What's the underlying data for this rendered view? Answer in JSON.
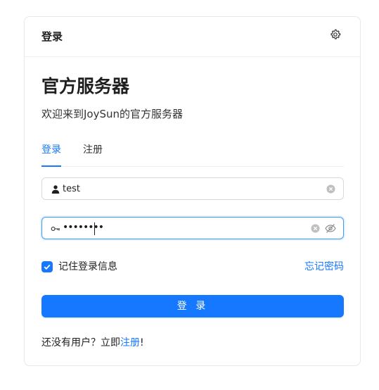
{
  "header": {
    "title": "登录",
    "settings_icon": "gear-icon"
  },
  "main": {
    "title": "官方服务器",
    "subtitle": "欢迎来到JoySun的官方服务器"
  },
  "tabs": [
    {
      "label": "登录",
      "active": true
    },
    {
      "label": "注册",
      "active": false
    }
  ],
  "form": {
    "username": {
      "value": "test",
      "prefix_icon": "user-icon",
      "clear_icon": "clear-icon"
    },
    "password": {
      "masked_value": "••••••••",
      "prefix_icon": "key-icon",
      "clear_icon": "clear-icon",
      "visibility_icon": "eye-invisible-icon",
      "focused": true
    },
    "remember": {
      "label": "记住登录信息",
      "checked": true
    },
    "forgot_label": "忘记密码",
    "submit_label": "登 录"
  },
  "footer": {
    "text": "还没有用户？立即",
    "link_label": "注册",
    "suffix": "!"
  },
  "colors": {
    "primary": "#1677ff",
    "border": "#d9d9d9",
    "focus_border": "#4096ff"
  }
}
